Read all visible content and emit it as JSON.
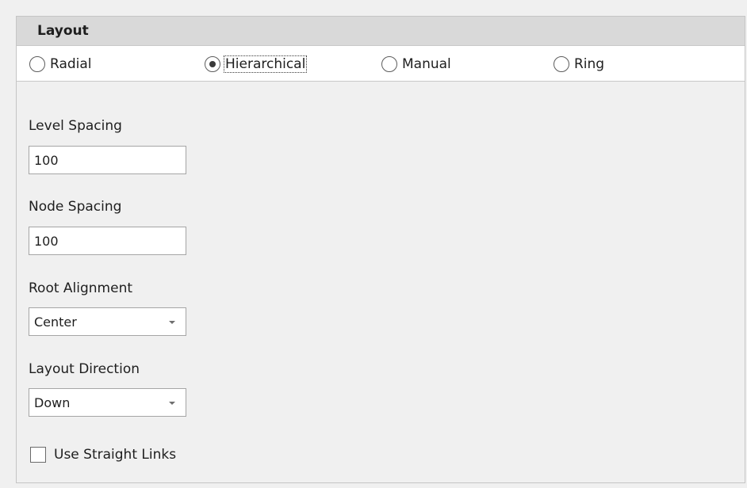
{
  "layout_group": {
    "title": "Layout",
    "options": [
      {
        "label": "Radial",
        "selected": false
      },
      {
        "label": "Hierarchical",
        "selected": true
      },
      {
        "label": "Manual",
        "selected": false
      },
      {
        "label": "Ring",
        "selected": false
      }
    ]
  },
  "level_spacing": {
    "label": "Level Spacing",
    "value": "100"
  },
  "node_spacing": {
    "label": "Node Spacing",
    "value": "100"
  },
  "root_alignment": {
    "label": "Root Alignment",
    "value": "Center"
  },
  "layout_direction": {
    "label": "Layout Direction",
    "value": "Down"
  },
  "straight_links": {
    "label": "Use Straight Links",
    "checked": false
  }
}
